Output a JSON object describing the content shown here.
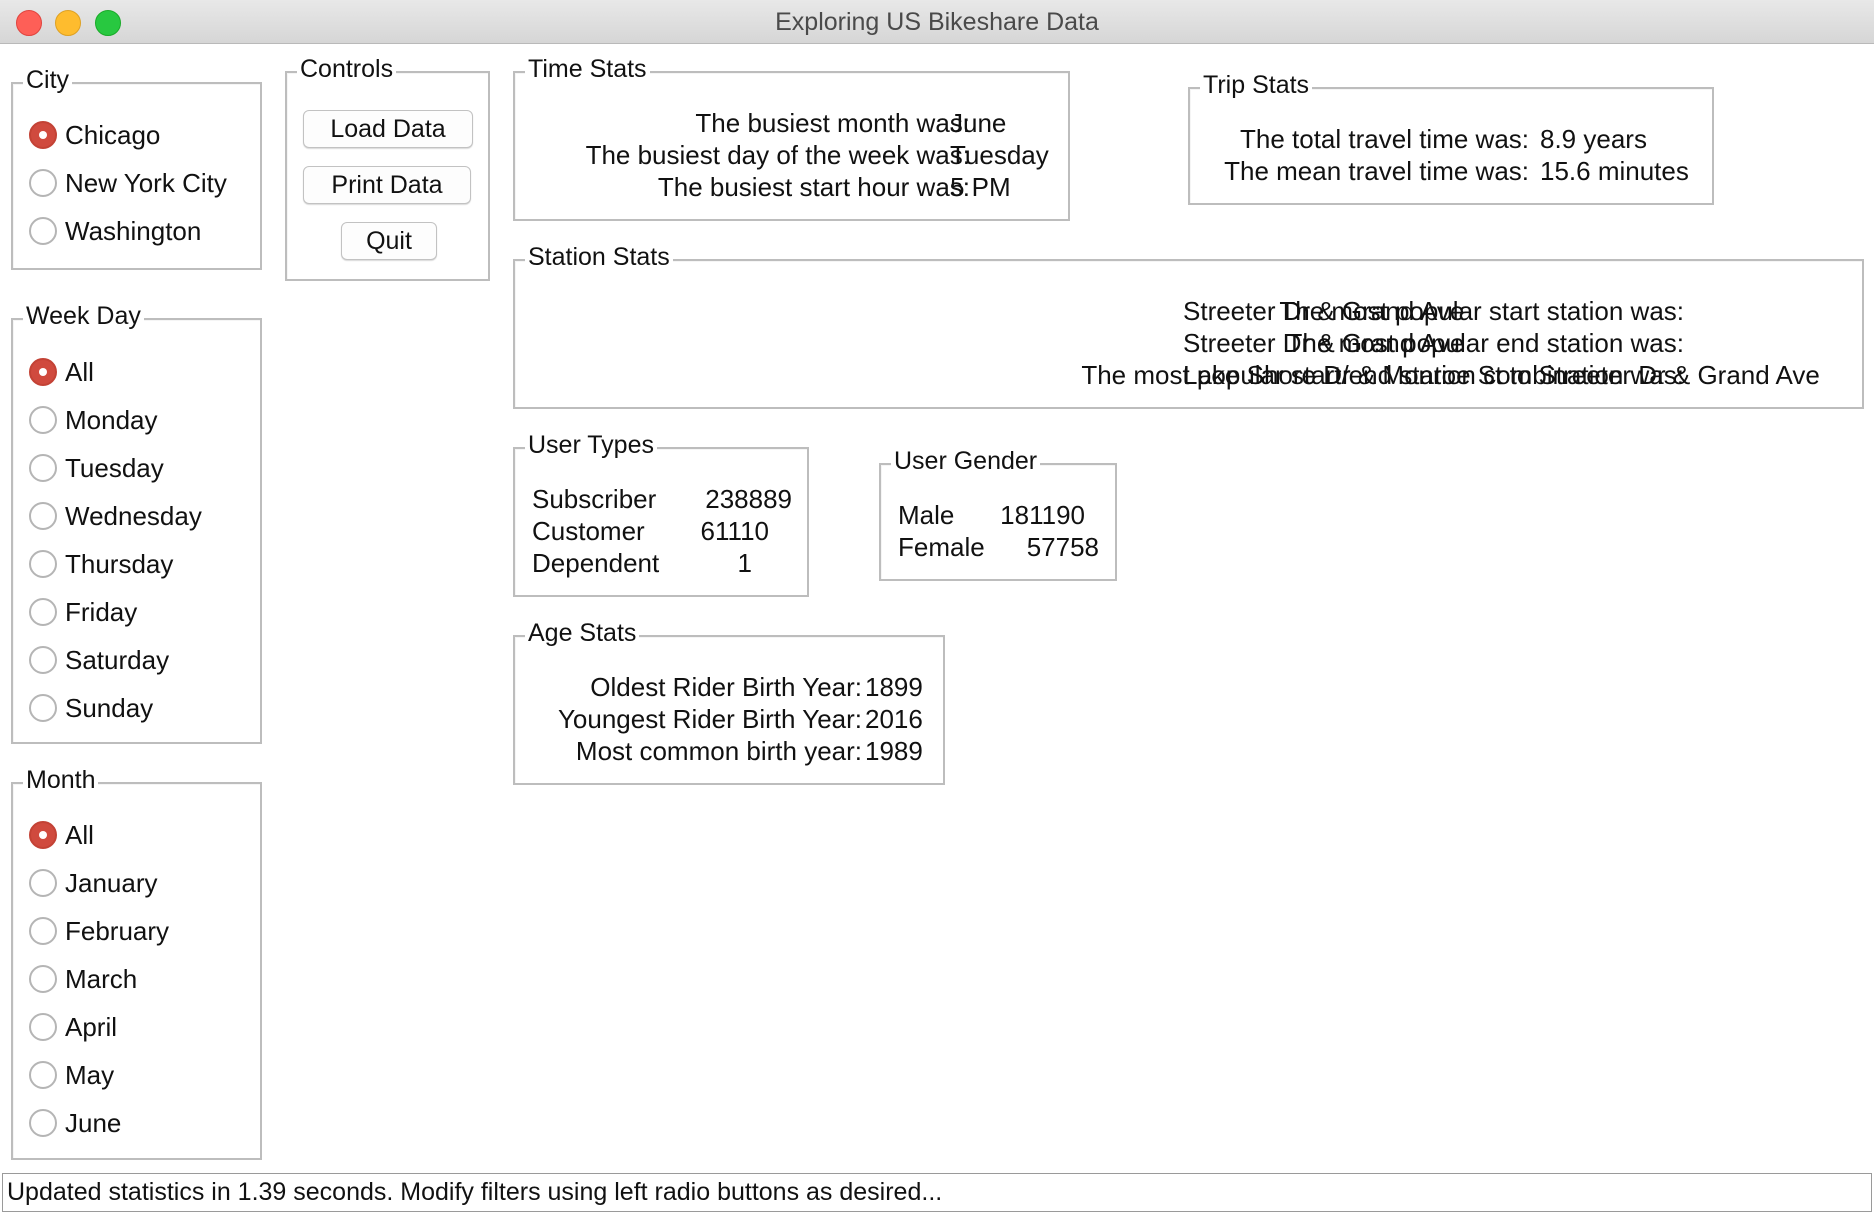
{
  "window": {
    "title": "Exploring US Bikeshare Data"
  },
  "city": {
    "legend": "City",
    "options": [
      "Chicago",
      "New York City",
      "Washington"
    ],
    "selected": "Chicago"
  },
  "weekday": {
    "legend": "Week Day",
    "options": [
      "All",
      "Monday",
      "Tuesday",
      "Wednesday",
      "Thursday",
      "Friday",
      "Saturday",
      "Sunday"
    ],
    "selected": "All"
  },
  "month": {
    "legend": "Month",
    "options": [
      "All",
      "January",
      "February",
      "March",
      "April",
      "May",
      "June"
    ],
    "selected": "All"
  },
  "controls": {
    "legend": "Controls",
    "load_label": "Load Data",
    "print_label": "Print Data",
    "quit_label": "Quit"
  },
  "time_stats": {
    "legend": "Time Stats",
    "rows": [
      {
        "label": "The busiest month was:",
        "value": "June"
      },
      {
        "label": "The busiest day of the week was:",
        "value": "Tuesday"
      },
      {
        "label": "The busiest start hour was:",
        "value": "5 PM"
      }
    ]
  },
  "trip_stats": {
    "legend": "Trip Stats",
    "rows": [
      {
        "label": "The total travel time was:",
        "value": "8.9 years"
      },
      {
        "label": "The mean travel time was:",
        "value": "15.6 minutes"
      }
    ]
  },
  "station_stats": {
    "legend": "Station Stats",
    "rows": [
      {
        "label": "The most popular start station was:",
        "value": "Streeter Dr & Grand Ave"
      },
      {
        "label": "The most popular end station was:",
        "value": "Streeter Dr & Grand Ave"
      },
      {
        "label": "The most popular start/end station combination was:",
        "value": "Lake Shore Dr & Monroe St to Streeter Dr & Grand Ave"
      }
    ]
  },
  "user_types": {
    "legend": "User Types",
    "rows": [
      {
        "label": "Subscriber",
        "value": "238889"
      },
      {
        "label": "Customer",
        "value": "61110"
      },
      {
        "label": "Dependent",
        "value": "1"
      }
    ]
  },
  "user_gender": {
    "legend": "User Gender",
    "rows": [
      {
        "label": "Male",
        "value": "181190"
      },
      {
        "label": "Female",
        "value": "57758"
      }
    ]
  },
  "age_stats": {
    "legend": "Age Stats",
    "rows": [
      {
        "label": "Oldest Rider Birth Year:",
        "value": "1899"
      },
      {
        "label": "Youngest Rider Birth Year:",
        "value": "2016"
      },
      {
        "label": "Most common birth year:",
        "value": "1989"
      }
    ]
  },
  "status": {
    "text": "Updated statistics in 1.39 seconds. Modify filters using left radio buttons as desired..."
  },
  "colors": {
    "radio_selected": "#d04a3e",
    "titlebar": "#dcdcdc",
    "border": "#bdbdbd"
  }
}
